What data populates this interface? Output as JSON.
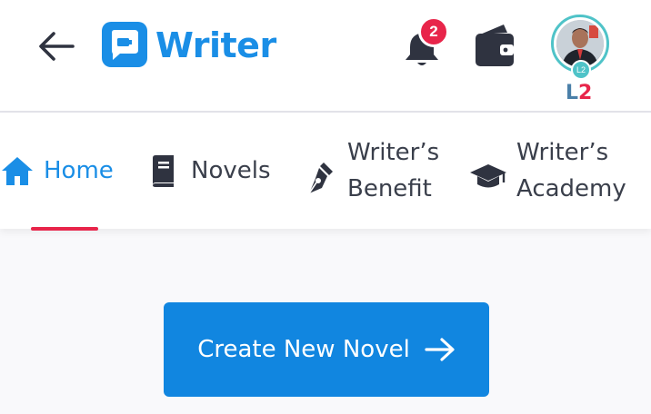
{
  "header": {
    "back_icon": "arrow-left-icon",
    "logo_icon": "writer-logo-icon",
    "brand": "Writer",
    "notifications": {
      "icon": "bell-icon",
      "count": "2"
    },
    "wallet_icon": "wallet-icon",
    "avatar": {
      "level_chip": "L2",
      "level_letter": "L",
      "level_number": "2"
    }
  },
  "nav": {
    "items": [
      {
        "icon": "home-icon",
        "label": "Home",
        "active": true
      },
      {
        "icon": "book-icon",
        "label": "Novels"
      },
      {
        "icon": "pen-nib-icon",
        "label_line1": "Writer’s",
        "label_line2": "Benefit"
      },
      {
        "icon": "graduation-cap-icon",
        "label_line1": "Writer’s",
        "label_line2": "Academy"
      }
    ]
  },
  "cta": {
    "label": "Create New Novel",
    "icon": "arrow-right-icon"
  },
  "colors": {
    "accent": "#1a8ee6",
    "badge": "#e8254a",
    "avatar_ring": "#4fc3c8",
    "text": "#3a3f4b"
  }
}
